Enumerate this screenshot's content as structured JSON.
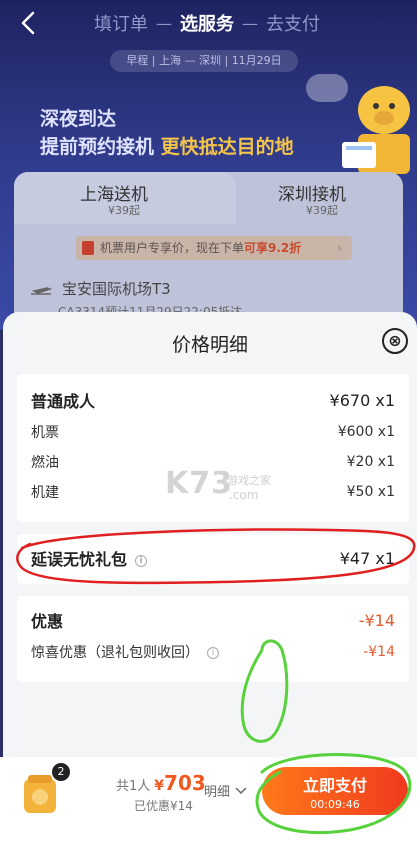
{
  "header": {
    "steps": [
      "填订单",
      "选服务",
      "去支付"
    ],
    "separator": "—",
    "trip_info": "早程 | 上海 — 深圳 | 11月29日"
  },
  "promo": {
    "line1": "深夜到达",
    "line2_prefix": "提前预约接机",
    "line2_highlight": "更快抵达目的地"
  },
  "service_tabs": [
    {
      "title": "上海送机",
      "sub": "¥39起"
    },
    {
      "title": "深圳接机",
      "sub": "¥39起"
    }
  ],
  "notice": {
    "text": "机票用户专享价，现在下单",
    "highlight": "可享9.2折"
  },
  "airport": {
    "name": "宝安国际机场T3",
    "flight": "CA3314预计11月29日22:05抵达"
  },
  "price_detail": {
    "title": "价格明细",
    "close_icon": "⊗",
    "adult": {
      "label": "普通成人",
      "amount": "¥670 x1",
      "items": [
        {
          "label": "机票",
          "amount": "¥600 x1"
        },
        {
          "label": "燃油",
          "amount": "¥20 x1"
        },
        {
          "label": "机建",
          "amount": "¥50 x1"
        }
      ]
    },
    "delay_package": {
      "label": "延误无忧礼包",
      "amount": "¥47 x1"
    },
    "discount": {
      "label": "优惠",
      "amount": "-¥14",
      "items": [
        {
          "label": "惊喜优惠（退礼包则收回）",
          "amount": "-¥14"
        }
      ]
    }
  },
  "watermark": {
    "main": "K73",
    "sub": "游戏之家",
    "domain": ".com"
  },
  "bottom_bar": {
    "cart_badge": "2",
    "pax": "共1人",
    "currency": "¥",
    "total": "703",
    "saved": "已优惠¥14",
    "detail_label": "明细",
    "pay_label": "立即支付",
    "timer": "00:09:46"
  },
  "colors": {
    "accent_orange": "#f05a22",
    "annotation_red": "#e02020",
    "annotation_green": "#58d23c"
  }
}
